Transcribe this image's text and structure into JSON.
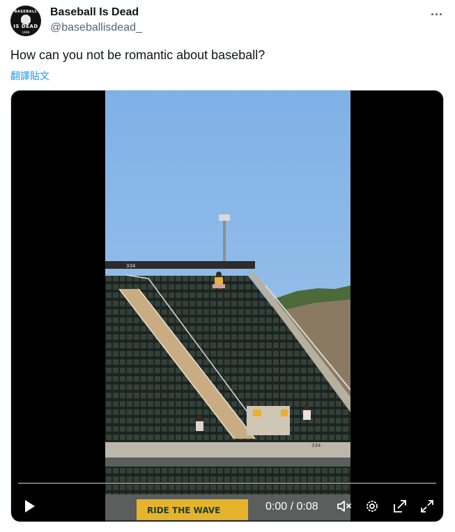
{
  "author": {
    "display_name": "Baseball Is Dead",
    "handle": "@baseballisdead_",
    "avatar_text_top": "BASEBALL",
    "avatar_text_mid": "IS DEAD",
    "avatar_text_bottom": "1999"
  },
  "tweet": {
    "text": "How can you not be romantic about baseball?",
    "translate_label": "翻譯貼文"
  },
  "video": {
    "section_left_number": "334",
    "section_right_number": "334",
    "banner_text": "RIDE THE WAVE",
    "time_display": "0:00 / 0:08",
    "progress": 0,
    "icons": {
      "play": "play-icon",
      "mute": "mute-icon",
      "settings": "settings-icon",
      "popout": "popout-icon",
      "fullscreen": "fullscreen-icon"
    }
  },
  "colors": {
    "link": "#1d9bf0",
    "text": "#0f1419",
    "secondary": "#536471",
    "sky": "#89b8e8",
    "seat": "#2b3530",
    "stairs": "#cbb08a",
    "banner": "#e7b52a"
  }
}
